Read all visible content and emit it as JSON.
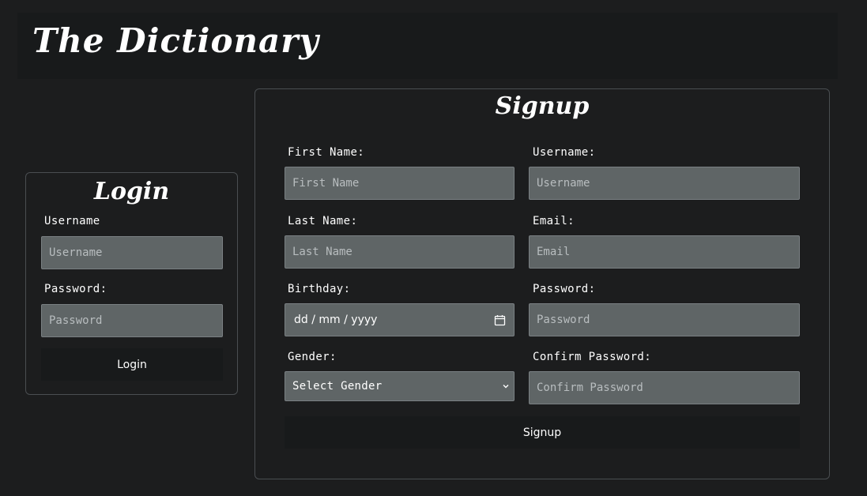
{
  "header": {
    "title": "The Dictionary"
  },
  "login": {
    "title": "Login",
    "username_label": "Username",
    "username_placeholder": "Username",
    "password_label": "Password:",
    "password_placeholder": "Password",
    "button_label": "Login"
  },
  "signup": {
    "title": "Signup",
    "first_name_label": "First Name:",
    "first_name_placeholder": "First Name",
    "username_label": "Username:",
    "username_placeholder": "Username",
    "last_name_label": "Last Name:",
    "last_name_placeholder": "Last Name",
    "email_label": "Email:",
    "email_placeholder": "Email",
    "birthday_label": "Birthday:",
    "birthday_placeholder": "dd / mm / yyyy",
    "password_label": "Password:",
    "password_placeholder": "Password",
    "gender_label": "Gender:",
    "gender_selected": "Select Gender",
    "confirm_password_label": "Confirm Password:",
    "confirm_password_placeholder": "Confirm Password",
    "button_label": "Signup"
  },
  "icons": {
    "calendar": "calendar-icon",
    "dropdown": "chevron-down-icon"
  },
  "colors": {
    "background": "#1c1d1e",
    "header_background": "#181a1b",
    "input_background": "#5f6566",
    "panel_border": "#4a4e51",
    "text": "#ffffff"
  }
}
